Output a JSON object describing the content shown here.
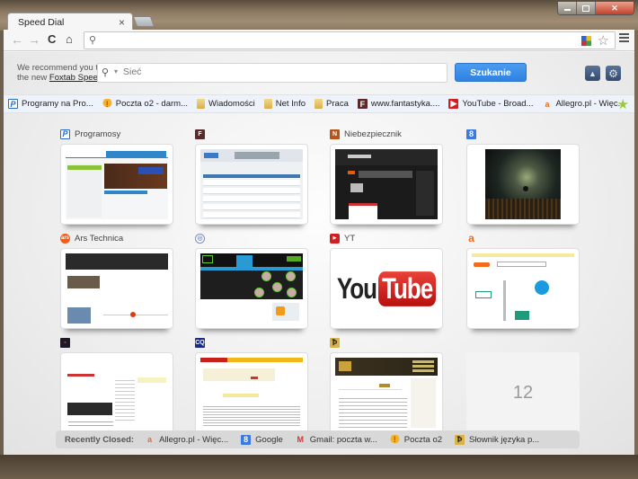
{
  "window": {
    "controls": {
      "minimize": "minimize",
      "maximize": "maximize",
      "close": "close"
    }
  },
  "tabs": [
    {
      "title": "Speed Dial",
      "close_glyph": "×"
    }
  ],
  "toolbar": {
    "back_glyph": "←",
    "forward_glyph": "→",
    "reload_glyph": "C",
    "home_glyph": "⌂",
    "omnibox_value": "",
    "omnibox_search_glyph": "⚲",
    "bookmark_star_glyph": "☆"
  },
  "promo": {
    "line1": "We recommend you to try",
    "line2_prefix": "the new ",
    "link_text": "Foxtab Speed Dial"
  },
  "search": {
    "placeholder": "Sieć",
    "engine_dropdown_glyph": "▾",
    "button_label": "Szukanie",
    "accent": "#3a8ee8"
  },
  "controls": {
    "collapse_glyph": "▲",
    "settings_glyph": "⚙"
  },
  "bookmarks": [
    {
      "label": "Programy na Pro...",
      "icon": "programosy-icon",
      "glyph": "P"
    },
    {
      "label": "Poczta o2 - darm...",
      "icon": "o2-icon",
      "glyph": "!"
    },
    {
      "label": "Wiadomości",
      "icon": "folder-icon",
      "glyph": ""
    },
    {
      "label": "Net Info",
      "icon": "folder-icon",
      "glyph": ""
    },
    {
      "label": "Praca",
      "icon": "folder-icon",
      "glyph": ""
    },
    {
      "label": "www.fantastyka....",
      "icon": "fantastyka-icon",
      "glyph": "F"
    },
    {
      "label": "YouTube - Broad...",
      "icon": "youtube-icon",
      "glyph": "▶"
    },
    {
      "label": "Allegro.pl - Więc...",
      "icon": "allegro-icon",
      "glyph": "a"
    }
  ],
  "bookmarks_extra_glyph": "★",
  "speed_dial": [
    {
      "index": 1,
      "title": "Programosy",
      "favicon": "programosy-icon",
      "glyph": "P",
      "thumb": "programosy"
    },
    {
      "index": 2,
      "title": "",
      "favicon": "fantastyka-icon",
      "glyph": "F",
      "thumb": "fantastyka"
    },
    {
      "index": 3,
      "title": "Niebezpiecznik",
      "favicon": "niebezpiecznik-icon",
      "glyph": "N",
      "thumb": "niebezpiecznik"
    },
    {
      "index": 4,
      "title": "",
      "favicon": "google-icon",
      "glyph": "8",
      "thumb": "google"
    },
    {
      "index": 5,
      "title": "Ars Technica",
      "favicon": "ars-technica-icon",
      "glyph": "ars",
      "thumb": "ars"
    },
    {
      "index": 6,
      "title": "",
      "favicon": "globe-icon",
      "glyph": "◎",
      "thumb": "webinar"
    },
    {
      "index": 7,
      "title": "YT",
      "favicon": "youtube-icon",
      "glyph": "▶",
      "thumb": "youtube"
    },
    {
      "index": 8,
      "title": "",
      "favicon": "allegro-icon",
      "glyph": "a",
      "thumb": "allegro"
    },
    {
      "index": 9,
      "title": "",
      "favicon": "dark-site-icon",
      "glyph": "▪",
      "thumb": "dark"
    },
    {
      "index": 10,
      "title": "",
      "favicon": "cq-icon",
      "glyph": "CQ",
      "thumb": "cq"
    },
    {
      "index": 11,
      "title": "",
      "favicon": "sjp-icon",
      "glyph": "Ꝥ",
      "thumb": "sjp"
    },
    {
      "index": 12,
      "title": "",
      "empty_label": "12"
    }
  ],
  "youtube_logo": {
    "you": "You",
    "tube": "Tube"
  },
  "recently_closed": {
    "label": "Recently Closed:",
    "items": [
      {
        "label": "Allegro.pl - Więc...",
        "icon": "allegro-icon",
        "glyph": "a"
      },
      {
        "label": "Google",
        "icon": "google-icon",
        "glyph": "8"
      },
      {
        "label": "Gmail: poczta w...",
        "icon": "gmail-icon",
        "glyph": "M"
      },
      {
        "label": "Poczta o2",
        "icon": "o2-icon",
        "glyph": "!"
      },
      {
        "label": "Słownik języka p...",
        "icon": "sjp-icon",
        "glyph": "Ꝥ"
      }
    ]
  }
}
